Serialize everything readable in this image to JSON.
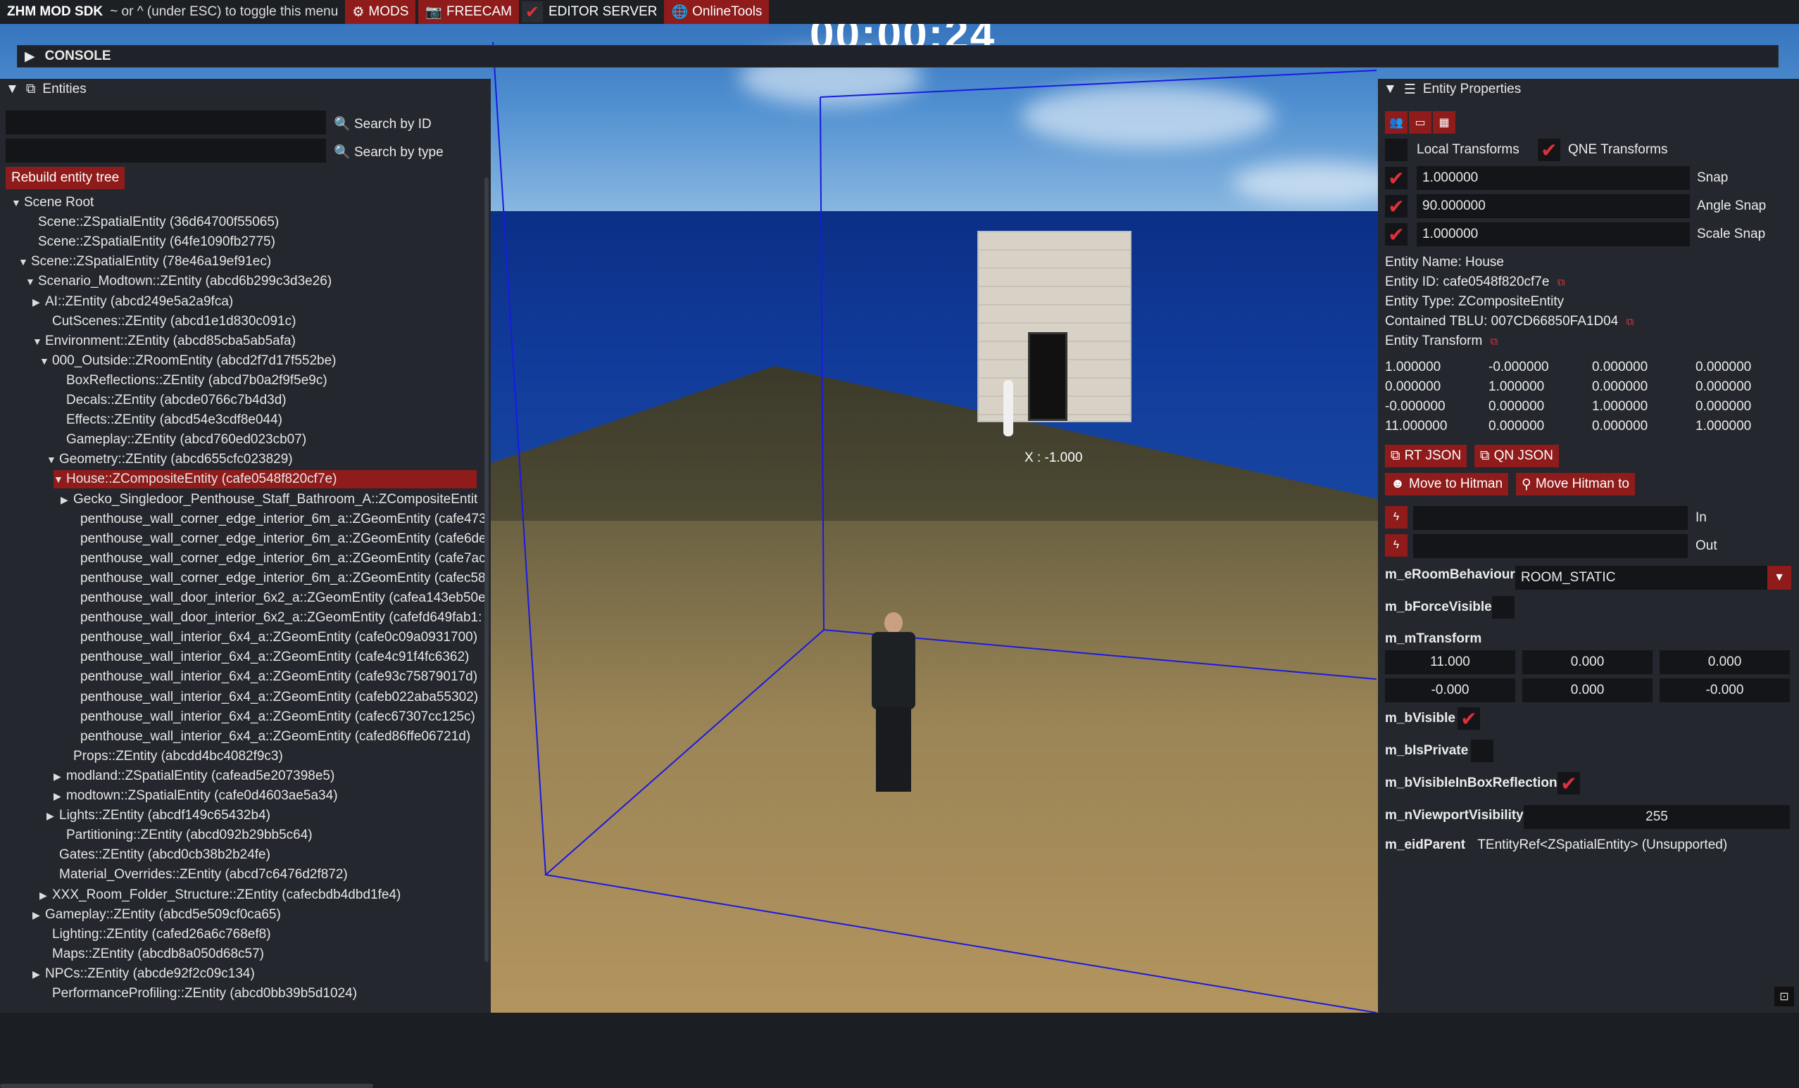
{
  "topbar": {
    "brand": "ZHM MOD SDK",
    "hint": "~ or ^ (under ESC) to toggle this menu",
    "mods": "MODS",
    "freecam": "FREECAM",
    "editor_server": "EDITOR SERVER",
    "online_tools": "OnlineTools"
  },
  "console": {
    "label": "CONSOLE"
  },
  "hud": {
    "timer": "00:00:24",
    "gizmo_label": "X : -1.000"
  },
  "entities": {
    "title": "Entities",
    "search_id_label": "Search by ID",
    "search_type_label": "Search by type",
    "search_id_value": "",
    "search_type_value": "",
    "rebuild": "Rebuild entity tree",
    "tree": [
      {
        "text": "Scene Root",
        "caret": "▼",
        "depth": 0
      },
      {
        "text": "Scene::ZSpatialEntity (36d64700f55065)",
        "caret": "",
        "depth": 1
      },
      {
        "text": "Scene::ZSpatialEntity (64fe1090fb2775)",
        "caret": "",
        "depth": 1
      },
      {
        "text": "Scene::ZSpatialEntity (78e46a19ef91ec)",
        "caret": "▼",
        "depth": 0.5
      },
      {
        "text": "Scenario_Modtown::ZEntity (abcd6b299c3d3e26)",
        "caret": "▼",
        "depth": 1
      },
      {
        "text": "AI::ZEntity (abcd249e5a2a9fca)",
        "caret": "▶",
        "depth": 1.5
      },
      {
        "text": "CutScenes::ZEntity (abcd1e1d830c091c)",
        "caret": "",
        "depth": 2
      },
      {
        "text": "Environment::ZEntity (abcd85cba5ab5afa)",
        "caret": "▼",
        "depth": 1.5
      },
      {
        "text": "000_Outside::ZRoomEntity (abcd2f7d17f552be)",
        "caret": "▼",
        "depth": 2
      },
      {
        "text": "BoxReflections::ZEntity (abcd7b0a2f9f5e9c)",
        "caret": "",
        "depth": 3
      },
      {
        "text": "Decals::ZEntity (abcde0766c7b4d3d)",
        "caret": "",
        "depth": 3
      },
      {
        "text": "Effects::ZEntity (abcd54e3cdf8e044)",
        "caret": "",
        "depth": 3
      },
      {
        "text": "Gameplay::ZEntity (abcd760ed023cb07)",
        "caret": "",
        "depth": 3
      },
      {
        "text": "Geometry::ZEntity (abcd655cfc023829)",
        "caret": "▼",
        "depth": 2.5
      },
      {
        "text": "House::ZCompositeEntity (cafe0548f820cf7e)",
        "caret": "▼",
        "depth": 3,
        "selected": true
      },
      {
        "text": "Gecko_Singledoor_Penthouse_Staff_Bathroom_A::ZCompositeEntit",
        "caret": "▶",
        "depth": 3.5
      },
      {
        "text": "penthouse_wall_corner_edge_interior_6m_a::ZGeomEntity (cafe473",
        "caret": "",
        "depth": 4
      },
      {
        "text": "penthouse_wall_corner_edge_interior_6m_a::ZGeomEntity (cafe6de",
        "caret": "",
        "depth": 4
      },
      {
        "text": "penthouse_wall_corner_edge_interior_6m_a::ZGeomEntity (cafe7ac",
        "caret": "",
        "depth": 4
      },
      {
        "text": "penthouse_wall_corner_edge_interior_6m_a::ZGeomEntity (cafec58",
        "caret": "",
        "depth": 4
      },
      {
        "text": "penthouse_wall_door_interior_6x2_a::ZGeomEntity (cafea143eb50e",
        "caret": "",
        "depth": 4
      },
      {
        "text": "penthouse_wall_door_interior_6x2_a::ZGeomEntity (cafefd649fab1:",
        "caret": "",
        "depth": 4
      },
      {
        "text": "penthouse_wall_interior_6x4_a::ZGeomEntity (cafe0c09a0931700)",
        "caret": "",
        "depth": 4
      },
      {
        "text": "penthouse_wall_interior_6x4_a::ZGeomEntity (cafe4c91f4fc6362)",
        "caret": "",
        "depth": 4
      },
      {
        "text": "penthouse_wall_interior_6x4_a::ZGeomEntity (cafe93c75879017d)",
        "caret": "",
        "depth": 4
      },
      {
        "text": "penthouse_wall_interior_6x4_a::ZGeomEntity (cafeb022aba55302)",
        "caret": "",
        "depth": 4
      },
      {
        "text": "penthouse_wall_interior_6x4_a::ZGeomEntity (cafec67307cc125c)",
        "caret": "",
        "depth": 4
      },
      {
        "text": "penthouse_wall_interior_6x4_a::ZGeomEntity (cafed86ffe06721d)",
        "caret": "",
        "depth": 4
      },
      {
        "text": "Props::ZEntity (abcdd4bc4082f9c3)",
        "caret": "",
        "depth": 3.5
      },
      {
        "text": "modland::ZSpatialEntity (cafead5e207398e5)",
        "caret": "▶",
        "depth": 3
      },
      {
        "text": "modtown::ZSpatialEntity (cafe0d4603ae5a34)",
        "caret": "▶",
        "depth": 3
      },
      {
        "text": "Lights::ZEntity (abcdf149c65432b4)",
        "caret": "▶",
        "depth": 2.5
      },
      {
        "text": "Partitioning::ZEntity (abcd092b29bb5c64)",
        "caret": "",
        "depth": 3
      },
      {
        "text": "Gates::ZEntity (abcd0cb38b2b24fe)",
        "caret": "",
        "depth": 2.5
      },
      {
        "text": "Material_Overrides::ZEntity (abcd7c6476d2f872)",
        "caret": "",
        "depth": 2.5
      },
      {
        "text": "XXX_Room_Folder_Structure::ZEntity (cafecbdb4dbd1fe4)",
        "caret": "▶",
        "depth": 2
      },
      {
        "text": "Gameplay::ZEntity (abcd5e509cf0ca65)",
        "caret": "▶",
        "depth": 1.5
      },
      {
        "text": "Lighting::ZEntity (cafed26a6c768ef8)",
        "caret": "",
        "depth": 2
      },
      {
        "text": "Maps::ZEntity (abcdb8a050d68c57)",
        "caret": "",
        "depth": 2
      },
      {
        "text": "NPCs::ZEntity (abcde92f2c09c134)",
        "caret": "▶",
        "depth": 1.5
      },
      {
        "text": "PerformanceProfiling::ZEntity (abcd0bb39b5d1024)",
        "caret": "",
        "depth": 2
      }
    ]
  },
  "props": {
    "title": "Entity Properties",
    "local_transforms": "Local Transforms",
    "qne_transforms": "QNE Transforms",
    "snap_value": "1.000000",
    "snap_label": "Snap",
    "angle_value": "90.000000",
    "angle_label": "Angle Snap",
    "scale_value": "1.000000",
    "scale_label": "Scale Snap",
    "entity_name": "Entity Name: House",
    "entity_id": "Entity ID: cafe0548f820cf7e",
    "entity_type": "Entity Type: ZCompositeEntity",
    "contained_tblu": "Contained TBLU: 007CD66850FA1D04",
    "entity_transform": "Entity Transform",
    "matrix": [
      [
        "1.000000",
        "-0.000000",
        "0.000000",
        "0.000000"
      ],
      [
        "0.000000",
        "1.000000",
        "0.000000",
        "0.000000"
      ],
      [
        "-0.000000",
        "0.000000",
        "1.000000",
        "0.000000"
      ],
      [
        "11.000000",
        "0.000000",
        "0.000000",
        "1.000000"
      ]
    ],
    "rt_json": "RT JSON",
    "qn_json": "QN JSON",
    "move_to_hitman": "Move to Hitman",
    "move_hitman_to": "Move Hitman to",
    "in_label": "In",
    "out_label": "Out",
    "room_behaviour_label": "m_eRoomBehaviour",
    "room_behaviour_value": "ROOM_STATIC",
    "force_visible_label": "m_bForceVisible",
    "transform_label": "m_mTransform",
    "transform_values": [
      "11.000",
      "0.000",
      "0.000",
      "-0.000",
      "0.000",
      "-0.000"
    ],
    "visible_label": "m_bVisible",
    "is_private_label": "m_bIsPrivate",
    "visible_box_label": "m_bVisibleInBoxReflection",
    "viewport_label": "m_nViewportVisibility",
    "viewport_value": "255",
    "eid_parent_label": "m_eidParent",
    "eid_parent_value": "TEntityRef<ZSpatialEntity> (Unsupported)"
  }
}
